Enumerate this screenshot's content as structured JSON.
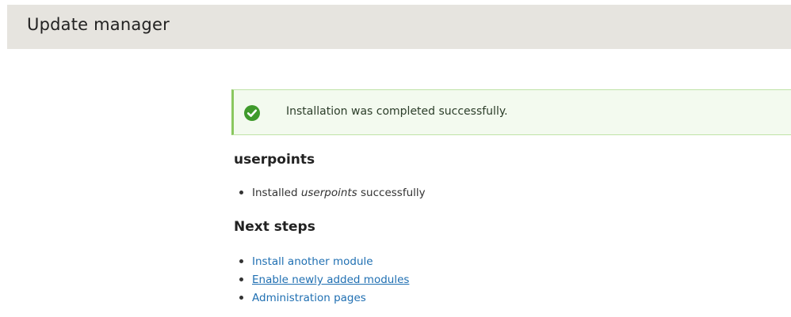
{
  "header": {
    "title": "Update manager"
  },
  "status": {
    "message": "Installation was completed successfully.",
    "icon": "check-circle-icon",
    "colors": {
      "border": "#8ac75f",
      "background": "#f3faef",
      "icon": "#3f9a2c"
    }
  },
  "module": {
    "heading": "userpoints",
    "result_prefix": "Installed ",
    "result_name": "userpoints",
    "result_suffix": " successfully"
  },
  "next_steps": {
    "heading": "Next steps",
    "links": [
      {
        "label": "Install another module"
      },
      {
        "label": "Enable newly added modules"
      },
      {
        "label": "Administration pages"
      }
    ]
  },
  "colors": {
    "link": "#1f6fb2",
    "header_bg": "#e6e4df"
  }
}
